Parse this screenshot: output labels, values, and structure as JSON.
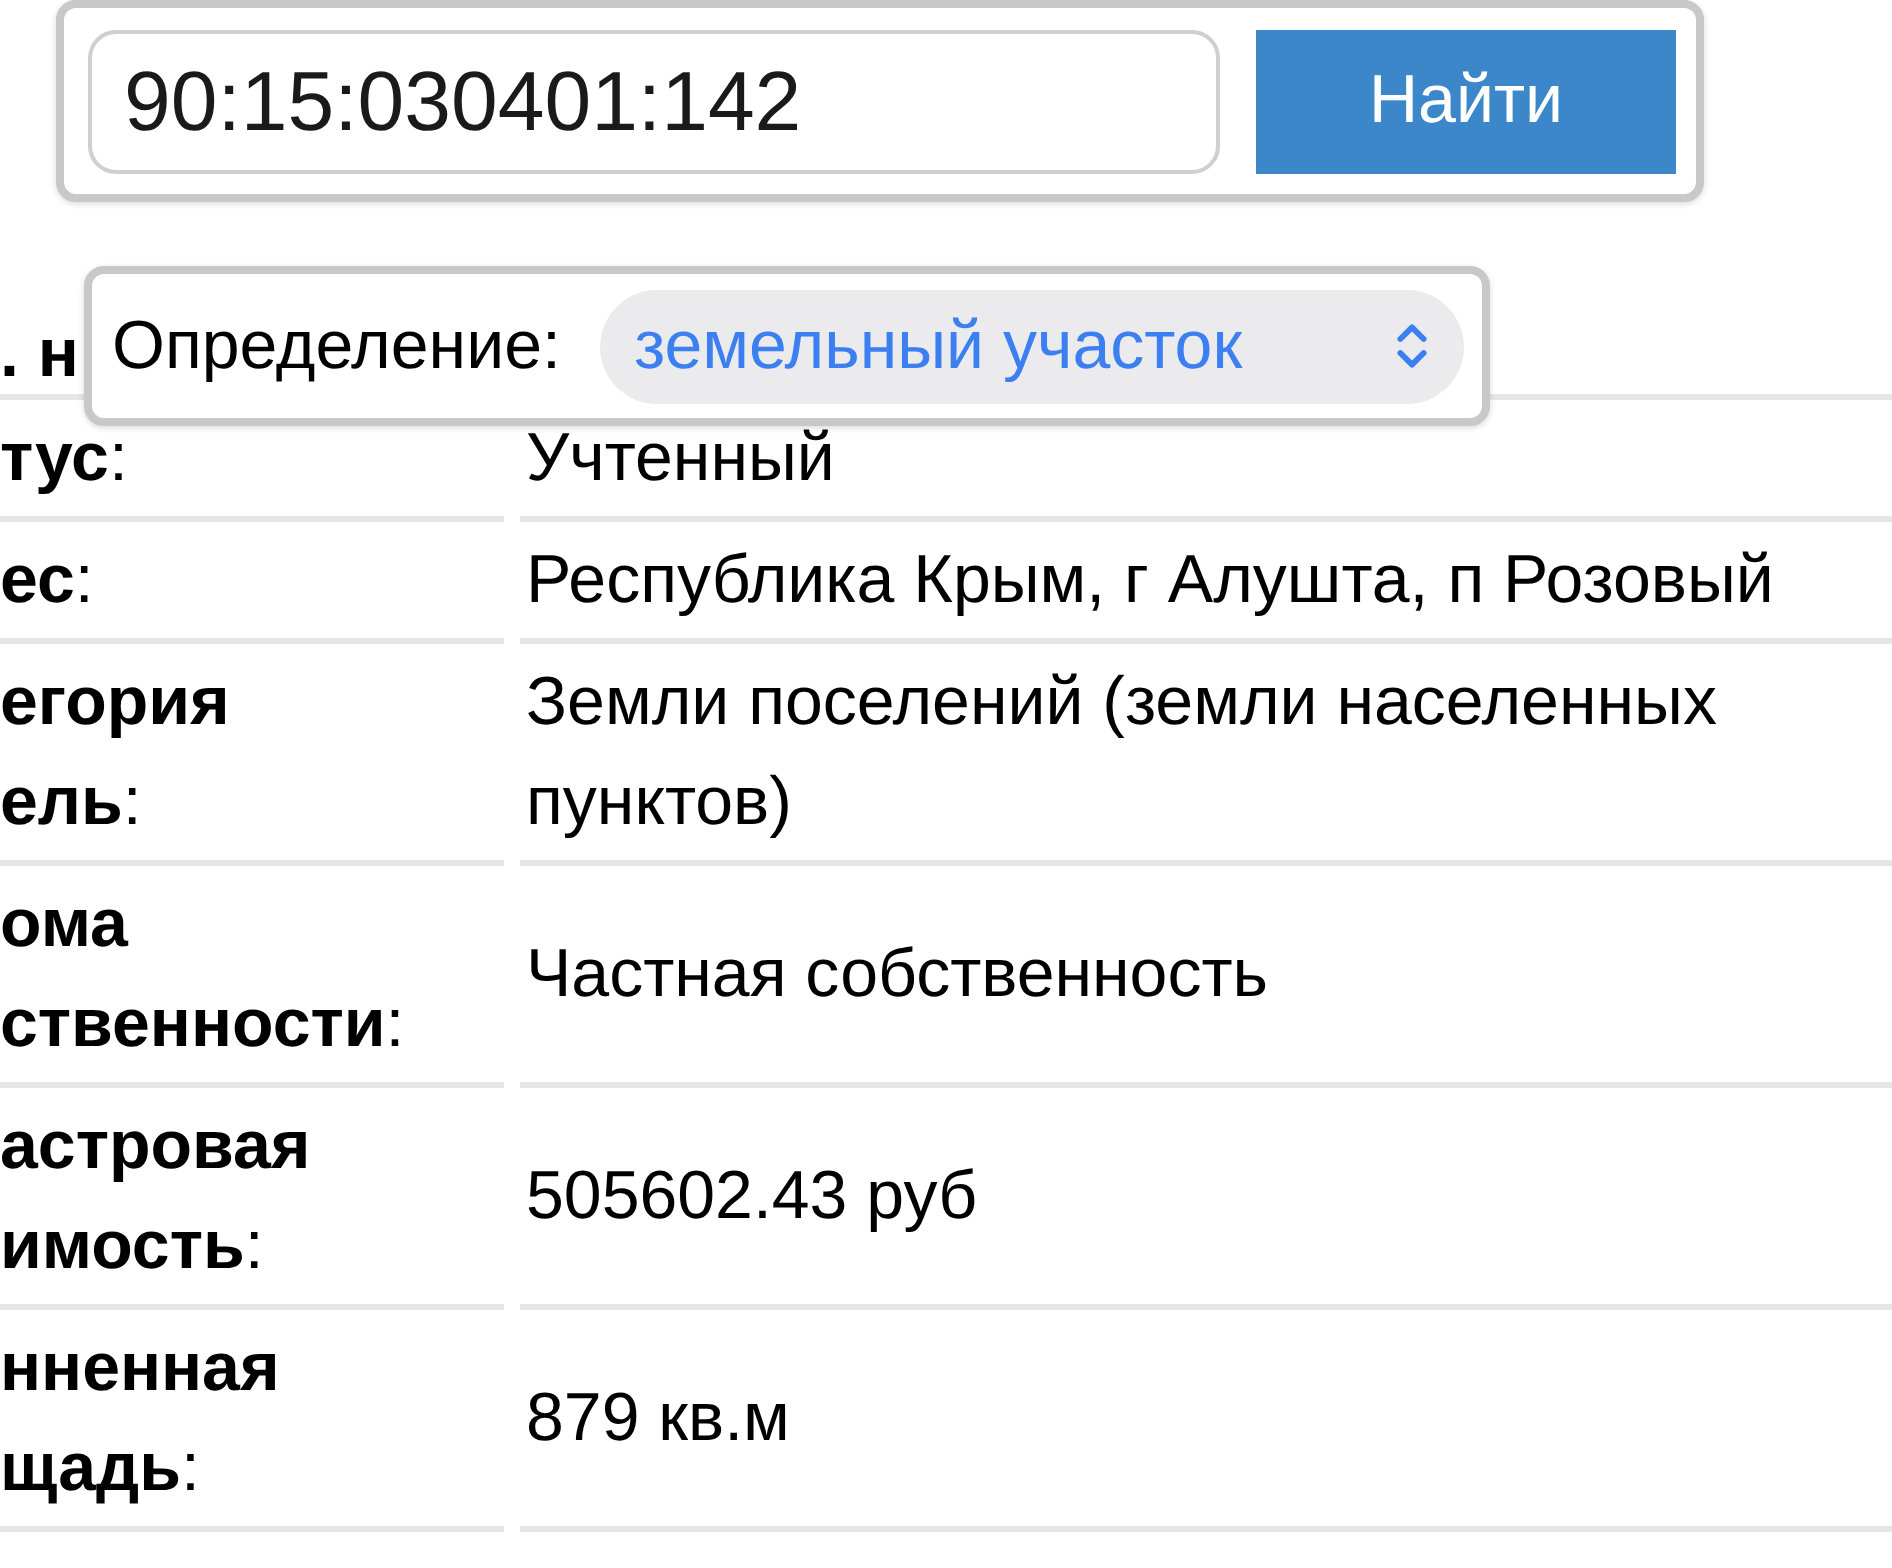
{
  "search": {
    "value": "90:15:030401:142",
    "button": "Найти"
  },
  "type_selector": {
    "label": "Определение:",
    "value": "земельный участок"
  },
  "covered_row": {
    "label": ". н"
  },
  "rows": [
    {
      "label_lines": [
        "**тус**:"
      ],
      "value": "Учтенный"
    },
    {
      "label_lines": [
        "**ес**:"
      ],
      "value": "Республика Крым, г Алушта, п Розовый"
    },
    {
      "label_lines": [
        "**егория**",
        "**ель**:"
      ],
      "value": "Земли поселений (земли населенных пунктов)"
    },
    {
      "label_lines": [
        "**ома**",
        "**ственности**:"
      ],
      "value": "Частная собственность"
    },
    {
      "label_lines": [
        "**астровая**",
        "**имость**:"
      ],
      "value": "505602.43 руб"
    },
    {
      "label_lines": [
        "**нненная**",
        "**щадь**:"
      ],
      "value": "879 кв.м"
    }
  ]
}
